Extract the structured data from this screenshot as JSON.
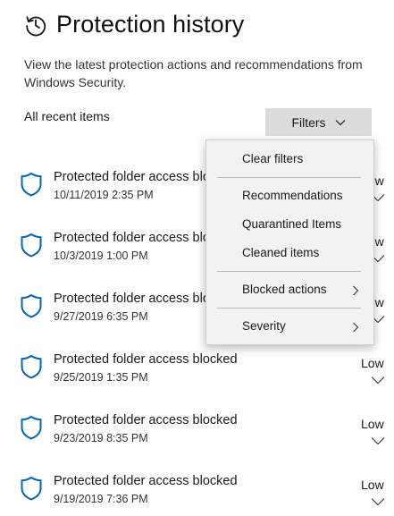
{
  "header": {
    "title": "Protection history",
    "icon": "history-icon"
  },
  "description": "View the latest protection actions and recommendations from Windows Security.",
  "section_label": "All recent items",
  "filters_button": {
    "label": "Filters",
    "icon": "chevron-down-icon"
  },
  "items": [
    {
      "title": "Protected folder access blocked",
      "date": "10/11/2019 2:35 PM",
      "severity": "Low"
    },
    {
      "title": "Protected folder access blocked",
      "date": "10/3/2019 1:00 PM",
      "severity": "Low"
    },
    {
      "title": "Protected folder access blocked",
      "date": "9/27/2019 6:35 PM",
      "severity": "Low"
    },
    {
      "title": "Protected folder access blocked",
      "date": "9/25/2019 1:35 PM",
      "severity": "Low"
    },
    {
      "title": "Protected folder access blocked",
      "date": "9/23/2019 8:35 PM",
      "severity": "Low"
    },
    {
      "title": "Protected folder access blocked",
      "date": "9/19/2019 7:36 PM",
      "severity": "Low"
    }
  ],
  "filters_menu": {
    "clear": "Clear filters",
    "recommendations": "Recommendations",
    "quarantined": "Quarantined Items",
    "cleaned": "Cleaned items",
    "blocked_actions": "Blocked actions",
    "severity": "Severity"
  },
  "colors": {
    "accent": "#0067b8",
    "button_bg": "#dcdcdc",
    "menu_bg": "#f2f2f2"
  }
}
